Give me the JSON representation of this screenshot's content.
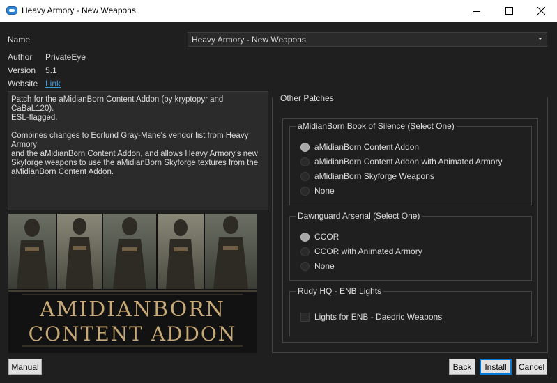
{
  "window": {
    "title": "Heavy Armory - New Weapons"
  },
  "info": {
    "name_label": "Name",
    "name_value": "Heavy Armory - New Weapons",
    "author_label": "Author",
    "author_value": "PrivateEye",
    "version_label": "Version",
    "version_value": "5.1",
    "website_label": "Website",
    "website_link": "Link"
  },
  "description": "Patch for the aMidianBorn Content Addon (by kryptopyr and CaBaL120).\nESL-flagged.\n\nCombines changes to Eorlund Gray-Mane's vendor list from Heavy Armory\nand the aMidianBorn Content Addon, and allows Heavy Armory's new\nSkyforge weapons to use the aMidianBorn Skyforge textures from the\naMidianBorn Content Addon.",
  "banner": {
    "line1": "AMIDIANBORN",
    "line2": "CONTENT ADDON"
  },
  "patches": {
    "title": "Other Patches",
    "groups": [
      {
        "title": "aMidianBorn Book of Silence (Select One)",
        "options": [
          {
            "label": "aMidianBorn Content Addon",
            "selected": true
          },
          {
            "label": "aMidianBorn Content Addon with Animated Armory",
            "selected": false
          },
          {
            "label": "aMidianBorn Skyforge Weapons",
            "selected": false
          },
          {
            "label": "None",
            "selected": false
          }
        ]
      },
      {
        "title": "Dawnguard Arsenal (Select One)",
        "options": [
          {
            "label": "CCOR",
            "selected": true
          },
          {
            "label": "CCOR with Animated Armory",
            "selected": false
          },
          {
            "label": "None",
            "selected": false
          }
        ]
      },
      {
        "title": "Rudy HQ - ENB Lights",
        "options": [
          {
            "label": "Lights for ENB - Daedric Weapons",
            "checked": false
          }
        ]
      }
    ]
  },
  "buttons": {
    "manual": "Manual",
    "back": "Back",
    "install": "Install",
    "cancel": "Cancel"
  },
  "colors": {
    "background": "#1f1f1f",
    "link": "#3d9bd9",
    "accent": "#0078d7"
  }
}
